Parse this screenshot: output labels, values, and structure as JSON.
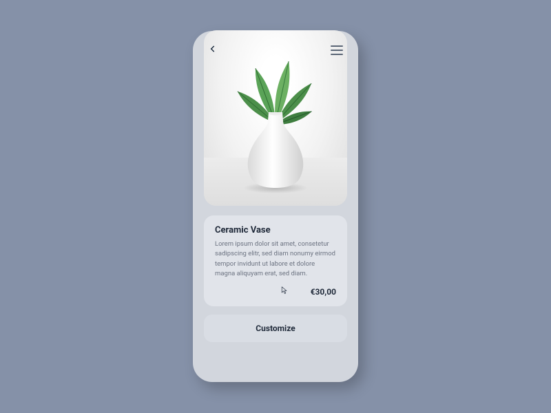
{
  "product": {
    "title": "Ceramic Vase",
    "description": "Lorem ipsum dolor sit amet, consetetur sadipscing elitr, sed diam nonumy eirmod tempor invidunt ut labore et dolore magna aliquyam erat, sed diam.",
    "price": "€30,00"
  },
  "actions": {
    "customize": "Customize"
  },
  "icons": {
    "back": "chevron-left-icon",
    "menu": "hamburger-icon",
    "cursor": "pointer-cursor-icon"
  }
}
